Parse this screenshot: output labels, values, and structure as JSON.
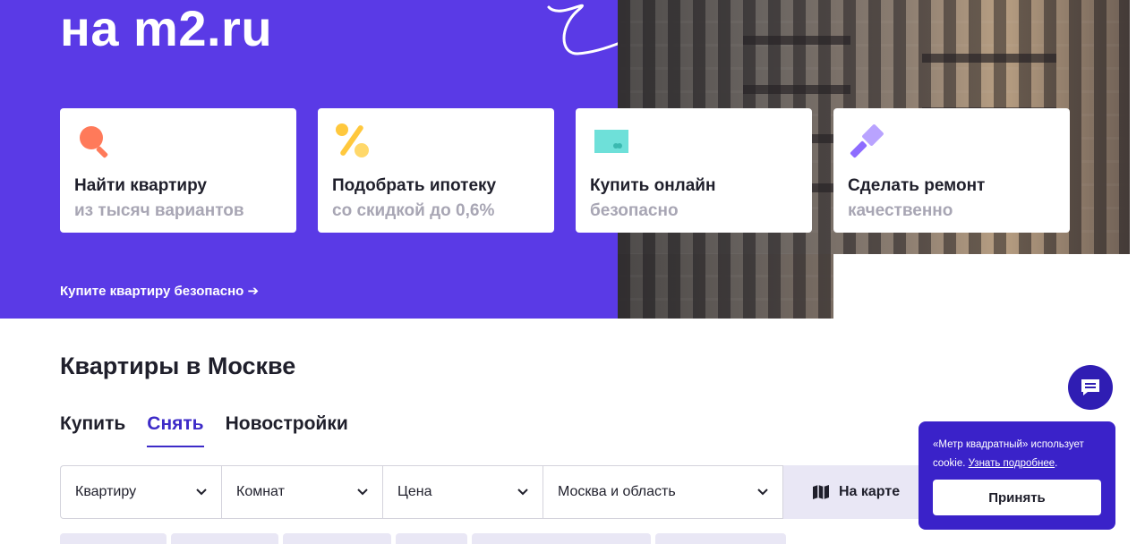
{
  "hero": {
    "title": "на m2.ru",
    "link": "Купите квартиру безопасно ➔",
    "background_color": "#5a3ae6"
  },
  "cards": [
    {
      "title": "Найти квартиру",
      "subtitle": "из тысяч вариантов",
      "icon": "search-magnifier-icon"
    },
    {
      "title": "Подобрать ипотеку",
      "subtitle": "со скидкой до 0,6%",
      "icon": "percent-icon"
    },
    {
      "title": "Купить онлайн",
      "subtitle": "безопасно",
      "icon": "card-icon"
    },
    {
      "title": "Сделать ремонт",
      "subtitle": "качественно",
      "icon": "paint-roller-icon"
    }
  ],
  "section": {
    "title": "Квартиры в Москве",
    "tabs": [
      {
        "label": "Купить",
        "active": false
      },
      {
        "label": "Снять",
        "active": true
      },
      {
        "label": "Новостройки",
        "active": false
      }
    ]
  },
  "filters": [
    {
      "label": "Квартиру"
    },
    {
      "label": "Комнат"
    },
    {
      "label": "Цена"
    },
    {
      "label": "Москва и область"
    }
  ],
  "map_button": {
    "label": "На карте",
    "icon": "map-icon"
  },
  "chat": {
    "icon": "chat-bubble-icon"
  },
  "cookie": {
    "text": "«Метр квадратный» использует cookie.",
    "link": "Узнать подробнее",
    "link_suffix": ".",
    "accept_label": "Принять"
  },
  "colors": {
    "accent": "#3d2bc8",
    "cookie_bg": "#3a22c9",
    "chat_bg": "#2f1db3"
  }
}
